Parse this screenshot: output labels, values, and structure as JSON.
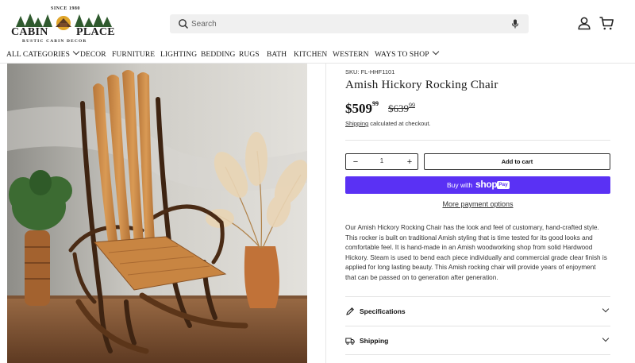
{
  "brand": {
    "since": "SINCE 1980",
    "name_left": "CABIN",
    "name_right": "PLACE",
    "tagline": "RUSTIC CABIN DECOR"
  },
  "search": {
    "placeholder": "Search"
  },
  "nav": {
    "items": [
      {
        "label": "ALL CATEGORIES",
        "dropdown": true
      },
      {
        "label": "DECOR"
      },
      {
        "label": "FURNITURE"
      },
      {
        "label": "LIGHTING"
      },
      {
        "label": "BEDDING"
      },
      {
        "label": "RUGS"
      },
      {
        "label": "BATH"
      },
      {
        "label": "KITCHEN"
      },
      {
        "label": "WESTERN"
      },
      {
        "label": "WAYS TO SHOP",
        "dropdown": true
      }
    ]
  },
  "product": {
    "sku": "SKU: FL-HHF1101",
    "title": "Amish Hickory Rocking Chair",
    "price_main": "$509",
    "price_cents": "99",
    "compare_main": "$639",
    "compare_cents": "99",
    "shipping_link": "Shipping",
    "shipping_note": " calculated at checkout.",
    "quantity": "1",
    "add_to_cart": "Add to cart",
    "buy_with": "Buy with",
    "shop_word": "shop",
    "pay_badge": "Pay",
    "more_payment": "More payment options",
    "description": "Our Amish Hickory Rocking Chair has the look and feel of customary, hand-crafted style. This rocker is built on traditional Amish styling that is time tested for its good looks and comfortable feel. It is hand-made in an Amish woodworking shop from solid Hardwood Hickory. Steam is used to bend each piece individually and commercial grade clear finish is applied for long lasting beauty. This Amish rocking chair will provide years of enjoyment that can be passed on to generation after generation.",
    "accordions": [
      {
        "label": "Specifications",
        "icon": "pencil-icon"
      },
      {
        "label": "Shipping",
        "icon": "truck-icon"
      }
    ]
  },
  "colors": {
    "shop_pay": "#5a31f4",
    "logo_green": "#2f5a2e",
    "logo_sun": "#e0a52a"
  }
}
